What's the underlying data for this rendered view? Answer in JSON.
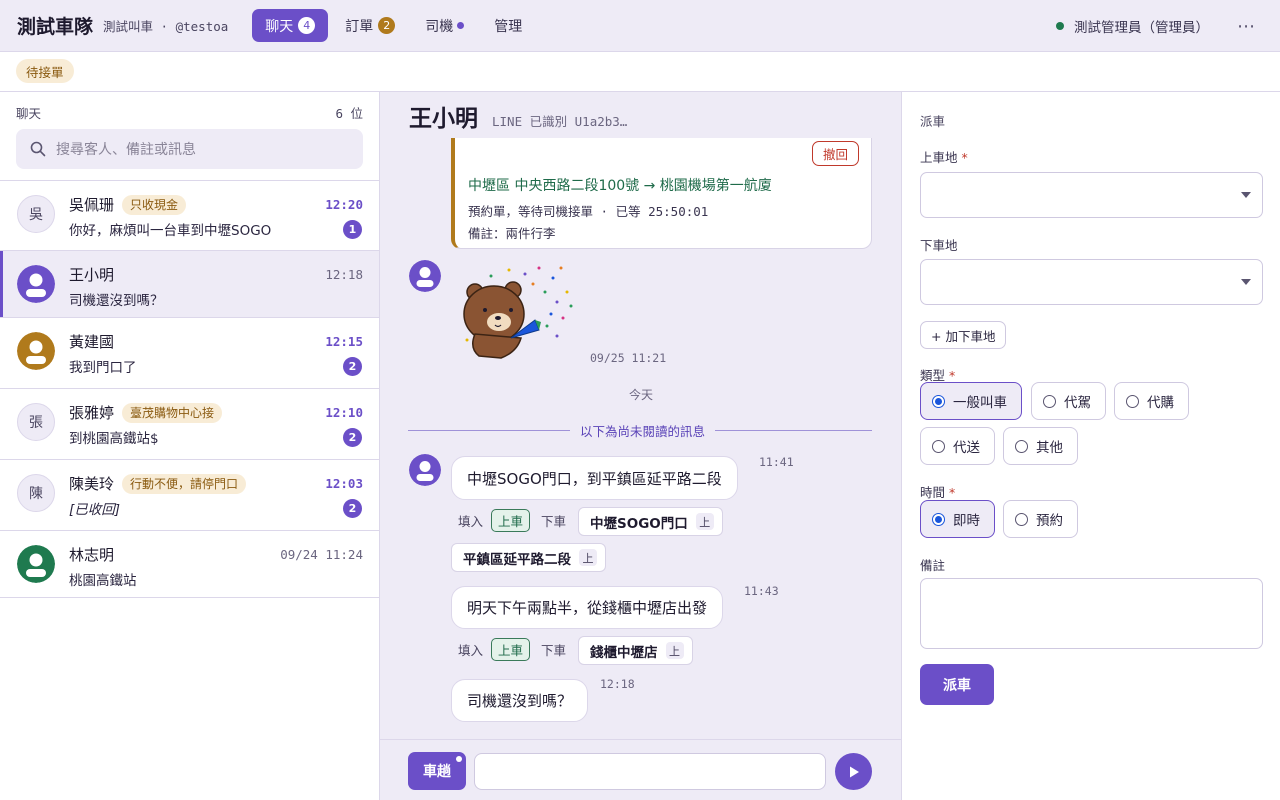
{
  "header": {
    "brand": "測試車隊",
    "brand_sub": "測試叫車 · @testoa",
    "tabs": [
      {
        "label": "聊天",
        "badge": "4"
      },
      {
        "label": "訂單",
        "badge": "2"
      },
      {
        "label": "司機"
      },
      {
        "label": "管理"
      }
    ],
    "admin": "測試管理員（管理員）",
    "more": "⋯"
  },
  "subbar": {
    "pending_label": "待接單"
  },
  "sidebar": {
    "title": "聊天",
    "count": "6 位",
    "search_placeholder": "搜尋客人、備註或訊息",
    "conversations": [
      {
        "avatar": "吳",
        "name": "吳佩珊",
        "tag": "只收現金",
        "message": "你好，麻煩叫一台車到中壢SOGO",
        "time": "12:20",
        "unread": "1"
      },
      {
        "name": "王小明",
        "message": "司機還沒到嗎？",
        "time": "12:18"
      },
      {
        "name": "黃建國",
        "message": "我到門口了",
        "time": "12:15",
        "unread": "2"
      },
      {
        "avatar": "張",
        "name": "張雅婷",
        "tag": "臺茂購物中心接",
        "message": "到桃園高鐵站$",
        "time": "12:10",
        "unread": "2"
      },
      {
        "avatar": "陳",
        "name": "陳美玲",
        "tag": "行動不便，請停門口",
        "message": "[已收回]",
        "time": "12:03",
        "unread": "2"
      },
      {
        "name": "林志明",
        "message": "桃園高鐵站",
        "time": "09/24 11:24"
      }
    ]
  },
  "chat": {
    "title": "王小明",
    "subtitle": "LINE 已識別  U1a2b3…",
    "order": {
      "recall_label": "撤回",
      "route": "中壢區 中央西路二段100號 → 桃園機場第一航廈",
      "status": "預約單，等待司機接單 · 已等 25:50:01",
      "note": "備註：兩件行李"
    },
    "sticker_time": "09/25 11:21",
    "today_label": "今天",
    "unread_divider": "以下為尚未閱讀的訊息",
    "fill_label": "填入",
    "pickup_chip": "上車",
    "dropoff_label": "下車",
    "up_mark": "上",
    "messages": [
      {
        "text": "中壢SOGO門口，到平鎮區延平路二段",
        "time": "11:41",
        "places": [
          "中壢SOGO門口",
          "平鎮區延平路二段"
        ]
      },
      {
        "text": "明天下午兩點半，從錢櫃中壢店出發",
        "time": "11:43",
        "places": [
          "錢櫃中壢店"
        ]
      },
      {
        "text": "司機還沒到嗎？",
        "time": "12:18"
      }
    ],
    "car_button": "車趟"
  },
  "dispatch": {
    "title": "派車",
    "pickup_label": "上車地",
    "dropoff_label": "下車地",
    "required_mark": "*",
    "add_stop": "+ 加下車地",
    "type_label": "類型",
    "types": [
      "一般叫車",
      "代駕",
      "代購",
      "代送",
      "其他"
    ],
    "time_label": "時間",
    "times": [
      "即時",
      "預約"
    ],
    "note_label": "備註",
    "submit": "派車"
  },
  "colors": {
    "accent": "#6b4fc8",
    "gold": "#b07a1c",
    "online": "#1f7a4f",
    "danger": "#c0392b",
    "route_green": "#1f6b4a"
  }
}
